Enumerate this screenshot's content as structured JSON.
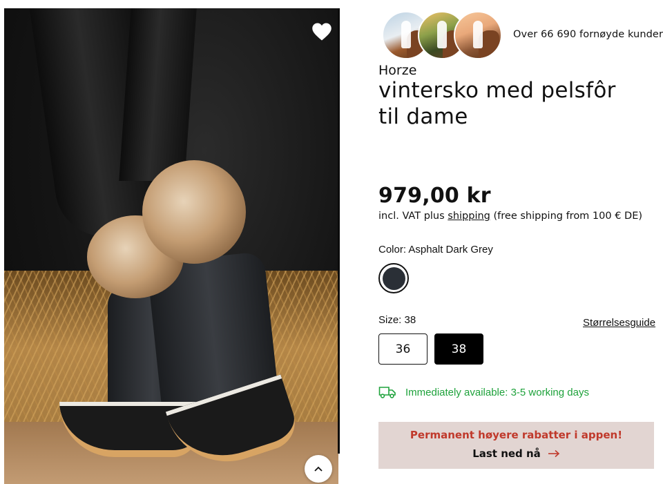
{
  "product": {
    "brand": "Horze",
    "title": "vintersko med pelsfôr til dame",
    "price": "979,00 kr",
    "vat_prefix": "incl. VAT plus",
    "vat_link": "shipping",
    "vat_suffix": "(free shipping from 100 € DE)"
  },
  "social_proof": {
    "customers_text": "Over 66 690 fornøyde kunder"
  },
  "color": {
    "label": "Color: Asphalt Dark Grey",
    "swatch_hex": "#2a2f36"
  },
  "size": {
    "label": "Size: 38",
    "guide_link": "Størrelsesguide",
    "options": [
      "36",
      "38"
    ],
    "selected": "38"
  },
  "availability": {
    "text": "Immediately available: 3-5 working days",
    "color": "#1ea23b"
  },
  "app_banner": {
    "promo": "Permanent høyere rabatter i appen!",
    "cta": "Last ned nå",
    "background": "#e2d5d2",
    "promo_color": "#c0392b"
  },
  "icons": [
    "heart-icon",
    "chevron-up-icon",
    "truck-icon",
    "arrow-right-icon"
  ]
}
